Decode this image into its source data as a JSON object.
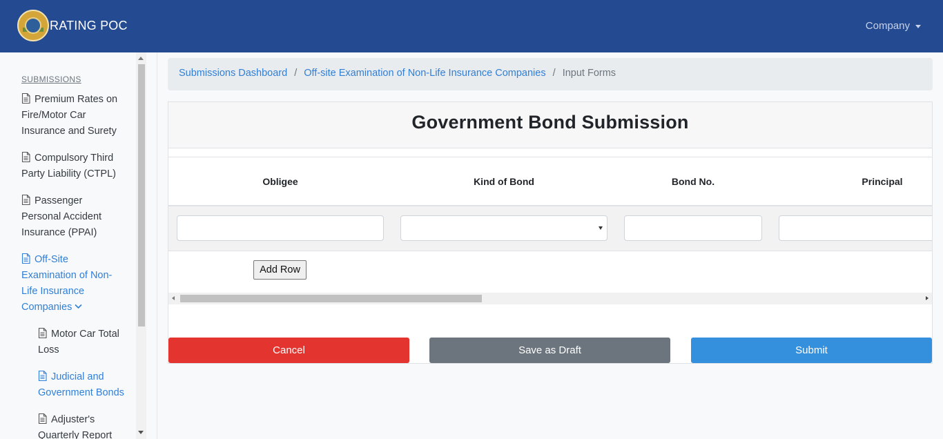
{
  "app": {
    "title": "RATING POC",
    "logo": "insurance-commission-seal",
    "user_menu_label": "Company"
  },
  "colors": {
    "navbar": "#244a92",
    "link": "#2f7fd8",
    "cancel": "#e3342f",
    "draft": "#6c757d",
    "submit": "#3490dc"
  },
  "sidebar": {
    "heading": "SUBMISSIONS",
    "items": [
      {
        "line1": "Premium Rates on",
        "line2": "Fire/Motor Car",
        "line3": "Insurance and Surety",
        "icon": "document-icon"
      },
      {
        "line1": "Compulsory Third",
        "line2": "Party Liability (CTPL)",
        "icon": "document-icon"
      },
      {
        "line1": "Passenger",
        "line2": "Personal Accident",
        "line3": "Insurance (PPAI)",
        "icon": "document-icon"
      },
      {
        "line1": "Off-Site",
        "line2": "Examination of Non-",
        "line3": "Life Insurance",
        "line4": "Companies",
        "icon": "document-icon",
        "active": true,
        "expanded": true
      }
    ],
    "subitems": [
      {
        "line1": "Motor Car Total",
        "line2": "Loss",
        "icon": "document-icon"
      },
      {
        "line1": "Judicial and",
        "line2": "Government Bonds",
        "icon": "document-icon",
        "active": true
      },
      {
        "line1": "Adjuster's",
        "line2": "Quarterly Report",
        "icon": "document-icon"
      }
    ]
  },
  "breadcrumb": {
    "items": [
      "Submissions Dashboard",
      "Off-site Examination of Non-Life Insurance Companies"
    ],
    "separator": "/",
    "current": "Input Forms"
  },
  "form": {
    "title": "Government Bond Submission",
    "columns": [
      "Obligee",
      "Kind of Bond",
      "Bond No.",
      "Principal"
    ],
    "row": {
      "obligee": "",
      "kind_of_bond": "",
      "bond_no": "",
      "principal": ""
    },
    "add_row_label": "Add Row",
    "buttons": {
      "cancel": "Cancel",
      "draft": "Save as Draft",
      "submit": "Submit"
    }
  }
}
